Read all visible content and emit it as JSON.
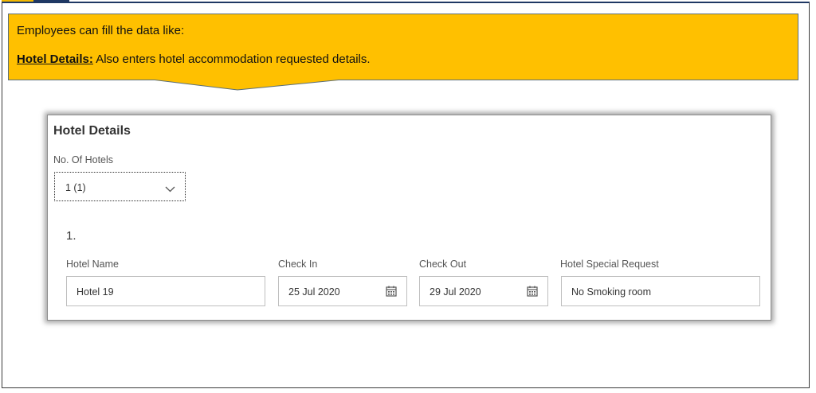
{
  "callout": {
    "line1": "Employees can fill the data like:",
    "key": "Hotel Details:",
    "line2_rest": " Also enters hotel accommodation requested details.",
    "color": "#ffc000"
  },
  "panel": {
    "title": "Hotel Details",
    "hotels_label": "No. Of Hotels",
    "hotels_value": "1 (1)",
    "index": "1.",
    "fields": {
      "hotel_name_label": "Hotel Name",
      "hotel_name_value": "Hotel 19",
      "check_in_label": "Check In",
      "check_in_value": "25 Jul 2020",
      "check_out_label": "Check Out",
      "check_out_value": "29 Jul 2020",
      "request_label": "Hotel Special Request",
      "request_value": "No Smoking room"
    }
  },
  "icons": {
    "select": "chevron-down-icon",
    "check_in": "calendar-icon",
    "check_out": "calendar-icon"
  }
}
